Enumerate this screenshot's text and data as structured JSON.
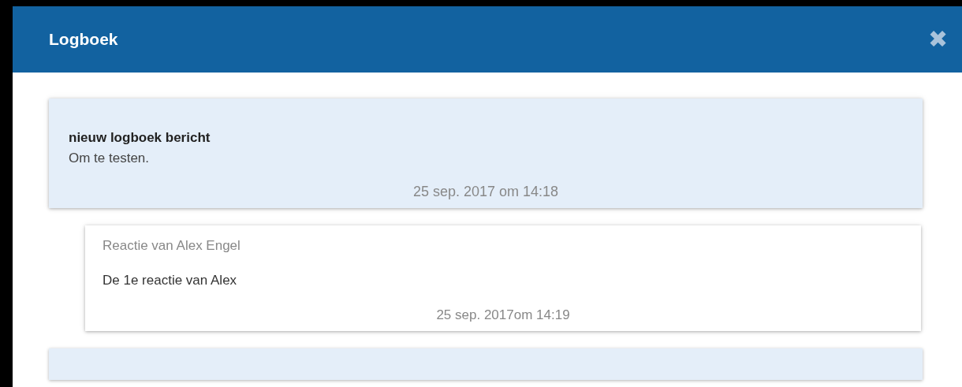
{
  "dialog": {
    "title": "Logboek",
    "close_label": "✖"
  },
  "posts": [
    {
      "title": "nieuw logboek bericht",
      "body": "Om te testen.",
      "date": "25 sep. 2017 om 14:18",
      "replies": [
        {
          "author": "Reactie van Alex Engel",
          "body": "De 1e reactie van Alex",
          "date": "25 sep. 2017om 14:19"
        }
      ]
    }
  ]
}
